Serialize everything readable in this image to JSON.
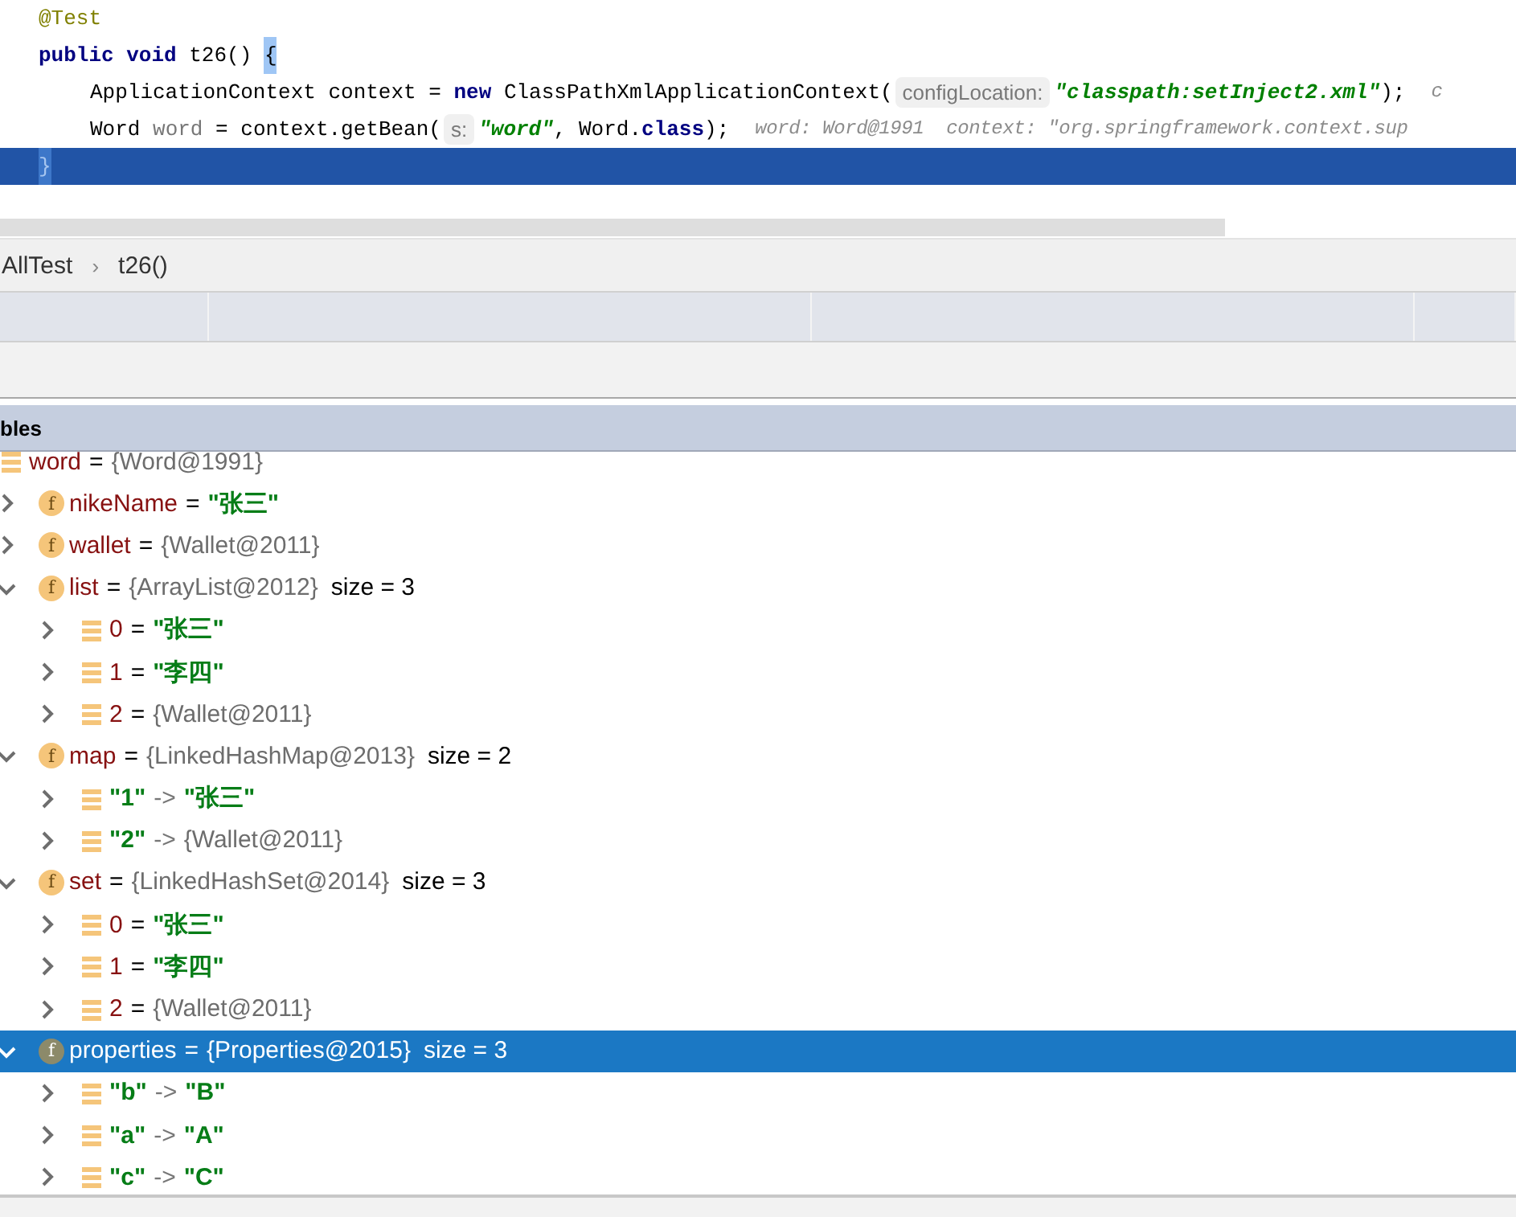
{
  "editor": {
    "lines": [
      {
        "current": false,
        "indented": false,
        "tokens": [
          {
            "kind": "annotation",
            "text": "@Test"
          }
        ]
      },
      {
        "current": false,
        "indented": false,
        "tokens": [
          {
            "kind": "keyword",
            "text": "public void"
          },
          {
            "kind": "plain",
            "text": " t26() "
          },
          {
            "kind": "brace_match",
            "text": "{"
          }
        ]
      },
      {
        "current": false,
        "indented": true,
        "tokens": [
          {
            "kind": "plain",
            "text": "ApplicationContext context = "
          },
          {
            "kind": "keyword",
            "text": "new"
          },
          {
            "kind": "plain",
            "text": " ClassPathXmlApplicationContext("
          },
          {
            "kind": "hint",
            "text": "configLocation:"
          },
          {
            "kind": "string",
            "text": "\"classpath:setInject2.xml\""
          },
          {
            "kind": "plain",
            "text": ");"
          },
          {
            "kind": "inline_value",
            "text": "c"
          }
        ]
      },
      {
        "current": false,
        "indented": true,
        "tokens": [
          {
            "kind": "plain",
            "text": "Word "
          },
          {
            "kind": "local",
            "text": "word"
          },
          {
            "kind": "plain",
            "text": " = context.getBean("
          },
          {
            "kind": "hint",
            "text": "s:"
          },
          {
            "kind": "string",
            "text": "\"word\""
          },
          {
            "kind": "plain",
            "text": ", Word."
          },
          {
            "kind": "keyword",
            "text": "class"
          },
          {
            "kind": "plain",
            "text": ");"
          },
          {
            "kind": "inline_value",
            "text": "word: Word@1991  context: \"org.springframework.context.sup"
          }
        ]
      },
      {
        "current": true,
        "indented": false,
        "tokens": [
          {
            "kind": "brace_match",
            "text": "}"
          }
        ]
      }
    ]
  },
  "breadcrumb": [
    "AllTest",
    "t26()"
  ],
  "breadcrumb_separator": "›",
  "variables_title": "bles",
  "variables": [
    {
      "kind": "element",
      "name": "word",
      "name_is_string": false,
      "separator": "=",
      "value": "{Word@1991}",
      "value_is_string": false,
      "selected": false,
      "children": [
        {
          "kind": "field",
          "badge": "f",
          "name": "nikeName",
          "name_is_string": false,
          "separator": "=",
          "value": "\"张三\"",
          "value_is_string": true,
          "expanded": false,
          "selected": false
        },
        {
          "kind": "field",
          "badge": "f",
          "name": "wallet",
          "name_is_string": false,
          "separator": "=",
          "value": "{Wallet@2011}",
          "value_is_string": false,
          "expanded": false,
          "selected": false
        },
        {
          "kind": "field",
          "badge": "f",
          "name": "list",
          "name_is_string": false,
          "separator": "=",
          "value": "{ArrayList@2012}",
          "value_is_string": false,
          "size": "size = 3",
          "expanded": true,
          "selected": false,
          "children": [
            {
              "kind": "element",
              "name": "0",
              "name_is_string": false,
              "separator": "=",
              "value": "\"张三\"",
              "value_is_string": true,
              "expanded": false,
              "selected": false
            },
            {
              "kind": "element",
              "name": "1",
              "name_is_string": false,
              "separator": "=",
              "value": "\"李四\"",
              "value_is_string": true,
              "expanded": false,
              "selected": false
            },
            {
              "kind": "element",
              "name": "2",
              "name_is_string": false,
              "separator": "=",
              "value": "{Wallet@2011}",
              "value_is_string": false,
              "expanded": false,
              "selected": false
            }
          ]
        },
        {
          "kind": "field",
          "badge": "f",
          "name": "map",
          "name_is_string": false,
          "separator": "=",
          "value": "{LinkedHashMap@2013}",
          "value_is_string": false,
          "size": "size = 2",
          "expanded": true,
          "selected": false,
          "children": [
            {
              "kind": "element",
              "name": "\"1\"",
              "name_is_string": true,
              "separator": "->",
              "value": "\"张三\"",
              "value_is_string": true,
              "expanded": false,
              "selected": false
            },
            {
              "kind": "element",
              "name": "\"2\"",
              "name_is_string": true,
              "separator": "->",
              "value": "{Wallet@2011}",
              "value_is_string": false,
              "expanded": false,
              "selected": false
            }
          ]
        },
        {
          "kind": "field",
          "badge": "f",
          "name": "set",
          "name_is_string": false,
          "separator": "=",
          "value": "{LinkedHashSet@2014}",
          "value_is_string": false,
          "size": "size = 3",
          "expanded": true,
          "selected": false,
          "children": [
            {
              "kind": "element",
              "name": "0",
              "name_is_string": false,
              "separator": "=",
              "value": "\"张三\"",
              "value_is_string": true,
              "expanded": false,
              "selected": false
            },
            {
              "kind": "element",
              "name": "1",
              "name_is_string": false,
              "separator": "=",
              "value": "\"李四\"",
              "value_is_string": true,
              "expanded": false,
              "selected": false
            },
            {
              "kind": "element",
              "name": "2",
              "name_is_string": false,
              "separator": "=",
              "value": "{Wallet@2011}",
              "value_is_string": false,
              "expanded": false,
              "selected": false
            }
          ]
        },
        {
          "kind": "field",
          "badge": "f",
          "name": "properties",
          "name_is_string": false,
          "separator": "=",
          "value": "{Properties@2015}",
          "value_is_string": false,
          "size": "size = 3",
          "expanded": true,
          "selected": true,
          "children": [
            {
              "kind": "element",
              "name": "\"b\"",
              "name_is_string": true,
              "separator": "->",
              "value": "\"B\"",
              "value_is_string": true,
              "expanded": false,
              "selected": false
            },
            {
              "kind": "element",
              "name": "\"a\"",
              "name_is_string": true,
              "separator": "->",
              "value": "\"A\"",
              "value_is_string": true,
              "expanded": false,
              "selected": false
            },
            {
              "kind": "element",
              "name": "\"c\"",
              "name_is_string": true,
              "separator": "->",
              "value": "\"C\"",
              "value_is_string": true,
              "expanded": false,
              "selected": false
            }
          ]
        }
      ]
    }
  ]
}
